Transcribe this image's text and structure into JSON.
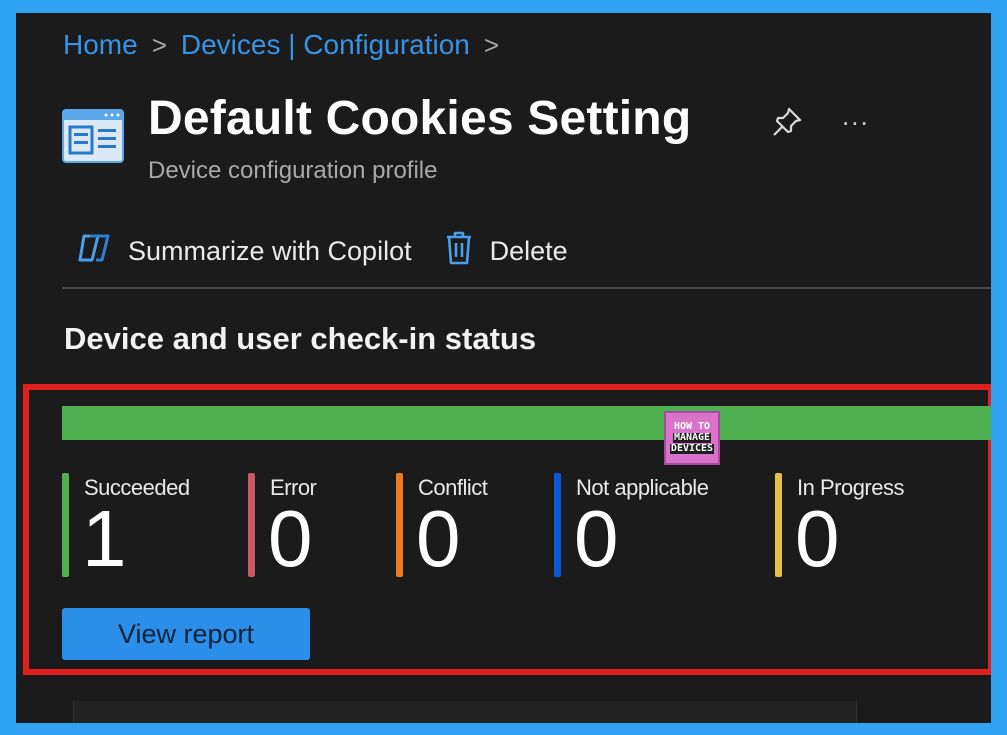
{
  "breadcrumb": {
    "items": [
      "Home",
      "Devices | Configuration"
    ],
    "separator": ">"
  },
  "header": {
    "title": "Default Cookies Setting",
    "subtitle": "Device configuration profile",
    "pin_icon": "pin-icon",
    "more_label": "..."
  },
  "toolbar": {
    "copilot_label": "Summarize with Copilot",
    "delete_label": "Delete"
  },
  "status": {
    "section_title": "Device and user check-in status",
    "progress_fraction": 1.0,
    "tiles": [
      {
        "label": "Succeeded",
        "value": "1",
        "color": "#4fb04f"
      },
      {
        "label": "Error",
        "value": "0",
        "color": "#c95a62"
      },
      {
        "label": "Conflict",
        "value": "0",
        "color": "#ee7b22"
      },
      {
        "label": "Not applicable",
        "value": "0",
        "color": "#0a59d6"
      },
      {
        "label": "In Progress",
        "value": "0",
        "color": "#e6c14a"
      }
    ],
    "view_report_label": "View report"
  },
  "watermark": {
    "line1": "HOW TO",
    "line2": "MANAGE",
    "line3": "DEVICES"
  },
  "colors": {
    "accent": "#2b8ee8",
    "highlight_border": "#e0201e",
    "background": "#1b1b1b",
    "frame": "#2fa3f2"
  }
}
